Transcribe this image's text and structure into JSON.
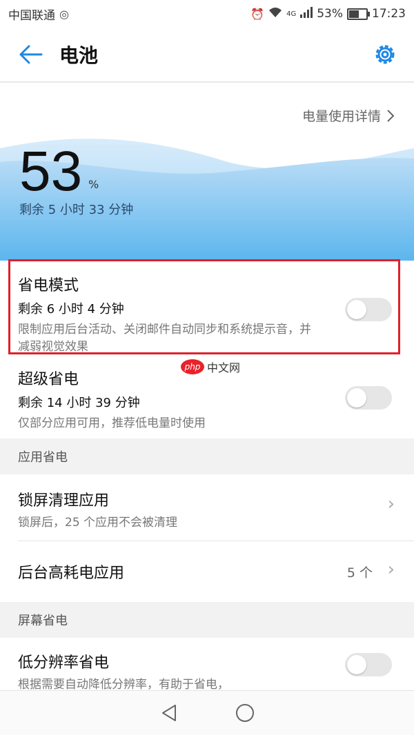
{
  "status_bar": {
    "carrier": "中国联通",
    "battery_percent": "53%",
    "time": "17:23",
    "network": "4G"
  },
  "appbar": {
    "title": "电池",
    "back_icon": "arrow-left-icon",
    "settings_icon": "gear-icon",
    "accent_color": "#1e88e5"
  },
  "hero": {
    "detail_link": "电量使用详情",
    "percent": "53",
    "percent_sign": "%",
    "remaining": "剩余 5 小时 33 分钟"
  },
  "power_saving": {
    "title": "省电模式",
    "remaining": "剩余 6 小时 4 分钟",
    "description": "限制应用后台活动、关闭邮件自动同步和系统提示音，并减弱视觉效果",
    "enabled": false
  },
  "ultra_saving": {
    "title": "超级省电",
    "remaining": "剩余 14 小时 39 分钟",
    "description": "仅部分应用可用，推荐低电量时使用",
    "enabled": false
  },
  "app_saving_section": {
    "header": "应用省电",
    "items": [
      {
        "title": "锁屏清理应用",
        "subtitle": "锁屏后，25 个应用不会被清理",
        "value": ""
      },
      {
        "title": "后台高耗电应用",
        "subtitle": "",
        "value": "5 个"
      }
    ]
  },
  "screen_saving_section": {
    "header": "屏幕省电",
    "low_resolution": {
      "title": "低分辨率省电",
      "description": "根据需要自动降低分辨率，有助于省电，",
      "enabled": false
    }
  },
  "watermark": {
    "badge": "php",
    "text": "中文网"
  },
  "highlight_color": "#e0202a"
}
